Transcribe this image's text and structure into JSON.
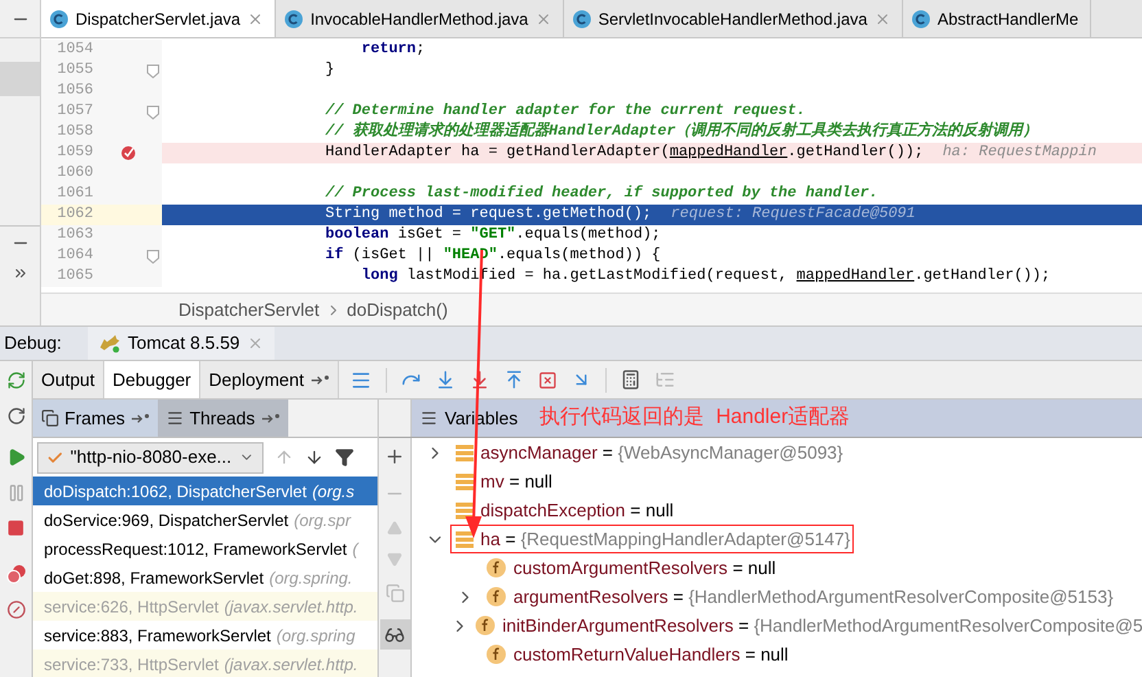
{
  "editor_tabs": [
    {
      "label": "DispatcherServlet.java",
      "selected": true
    },
    {
      "label": "InvocableHandlerMethod.java",
      "selected": false
    },
    {
      "label": "ServletInvocableHandlerMethod.java",
      "selected": false
    },
    {
      "label": "AbstractHandlerMe",
      "selected": false
    }
  ],
  "code_lines": [
    {
      "number": "1054",
      "current": false,
      "breakpoint": false,
      "fold": false,
      "segments": [
        {
          "kind": "keyword",
          "text": "    return"
        },
        {
          "kind": "plain",
          "text": ";"
        }
      ]
    },
    {
      "number": "1055",
      "current": false,
      "breakpoint": false,
      "fold": true,
      "segments": [
        {
          "kind": "plain",
          "text": "}"
        }
      ]
    },
    {
      "number": "1056",
      "current": false,
      "breakpoint": false,
      "fold": false
    },
    {
      "number": "1057",
      "current": false,
      "breakpoint": false,
      "fold": true,
      "segments": [
        {
          "kind": "comment",
          "text": "// Determine handler adapter for the current request."
        }
      ]
    },
    {
      "number": "1058",
      "current": false,
      "breakpoint": false,
      "fold": false,
      "segments": [
        {
          "kind": "comment",
          "text": "// 获取处理请求的处理器适配器HandlerAdapter（调用不同的反射工具类去执行真正方法的反射调用）"
        }
      ]
    },
    {
      "number": "1059",
      "current": false,
      "breakpoint": true,
      "fold": false,
      "segments": [
        {
          "kind": "plain",
          "text": "HandlerAdapter ha = getHandlerAdapter("
        },
        {
          "kind": "link",
          "text": "mappedHandler"
        },
        {
          "kind": "plain",
          "text": ".getHandler());"
        },
        {
          "kind": "hint",
          "text": "ha: RequestMappin"
        }
      ]
    },
    {
      "number": "1060",
      "current": false,
      "breakpoint": false,
      "fold": false
    },
    {
      "number": "1061",
      "current": false,
      "breakpoint": false,
      "fold": false,
      "segments": [
        {
          "kind": "comment",
          "text": "// Process last-modified header, if supported by the handler."
        }
      ]
    },
    {
      "number": "1062",
      "current": true,
      "breakpoint": false,
      "fold": false,
      "segments": [
        {
          "kind": "plain",
          "text": "String method = request.getMethod();"
        },
        {
          "kind": "hint",
          "text": "request: RequestFacade@5091"
        }
      ]
    },
    {
      "number": "1063",
      "current": false,
      "breakpoint": false,
      "fold": false,
      "segments": [
        {
          "kind": "keyword",
          "text": "boolean"
        },
        {
          "kind": "plain",
          "text": " isGet = "
        },
        {
          "kind": "string",
          "text": "\"GET\""
        },
        {
          "kind": "plain",
          "text": ".equals(method);"
        }
      ]
    },
    {
      "number": "1064",
      "current": false,
      "breakpoint": false,
      "fold": true,
      "segments": [
        {
          "kind": "keyword",
          "text": "if"
        },
        {
          "kind": "plain",
          "text": " (isGet || "
        },
        {
          "kind": "string",
          "text": "\"HEAD\""
        },
        {
          "kind": "plain",
          "text": ".equals(method)) {"
        }
      ]
    },
    {
      "number": "1065",
      "current": false,
      "breakpoint": false,
      "fold": false,
      "segments": [
        {
          "kind": "keyword",
          "text": "    long"
        },
        {
          "kind": "plain",
          "text": " lastModified = ha.getLastModified(request, "
        },
        {
          "kind": "link",
          "text": "mappedHandler"
        },
        {
          "kind": "plain",
          "text": ".getHandler());"
        }
      ]
    }
  ],
  "breadcrumb": [
    "DispatcherServlet",
    "doDispatch()"
  ],
  "debug": {
    "label": "Debug:",
    "session_tab": "Tomcat 8.5.59"
  },
  "debug_tabs": [
    {
      "label": "Output",
      "selected": false
    },
    {
      "label": "Debugger",
      "selected": true
    },
    {
      "label": "Deployment",
      "selected": false
    }
  ],
  "frames_tabs": [
    {
      "label": "Frames",
      "selected": true
    },
    {
      "label": "Threads",
      "selected": false
    }
  ],
  "thread_dropdown": "\"http-nio-8080-exe...",
  "frames": [
    {
      "method": "doDispatch:1062, DispatcherServlet",
      "package": "(org.s",
      "selected": true,
      "library": false
    },
    {
      "method": "doService:969, DispatcherServlet",
      "package": "(org.spr",
      "selected": false,
      "library": false
    },
    {
      "method": "processRequest:1012, FrameworkServlet",
      "package": "(",
      "selected": false,
      "library": false
    },
    {
      "method": "doGet:898, FrameworkServlet",
      "package": "(org.spring.",
      "selected": false,
      "library": false
    },
    {
      "method": "service:626, HttpServlet",
      "package": "(javax.servlet.http.",
      "selected": false,
      "library": true
    },
    {
      "method": "service:883, FrameworkServlet",
      "package": "(org.spring",
      "selected": false,
      "library": false
    },
    {
      "method": "service:733, HttpServlet",
      "package": "(javax.servlet.http.",
      "selected": false,
      "library": true
    }
  ],
  "variables_title": "Variables",
  "annotation": "执行代码返回的是  Handler适配器",
  "variables": [
    {
      "kind": "local",
      "name": "asyncManager",
      "op": "=",
      "value": "{WebAsyncManager@5093}",
      "grey_value": true,
      "expandable": true,
      "expanded": false,
      "annotated": false
    },
    {
      "kind": "local",
      "name": "mv",
      "op": "=",
      "value": "null",
      "grey_value": false,
      "expandable": false,
      "expanded": false,
      "annotated": false
    },
    {
      "kind": "local",
      "name": "dispatchException",
      "op": "=",
      "value": "null",
      "grey_value": false,
      "expandable": false,
      "expanded": false,
      "annotated": false
    },
    {
      "kind": "local",
      "name": "ha",
      "op": "=",
      "value": "{RequestMappingHandlerAdapter@5147}",
      "grey_value": true,
      "expandable": true,
      "expanded": true,
      "annotated": true,
      "children": [
        {
          "kind": "field",
          "name": "customArgumentResolvers",
          "op": "=",
          "value": "null",
          "grey_value": false,
          "expandable": false,
          "expanded": false,
          "annotated": false
        },
        {
          "kind": "field",
          "name": "argumentResolvers",
          "op": "=",
          "value": "{HandlerMethodArgumentResolverComposite@5153}",
          "grey_value": true,
          "expandable": true,
          "expanded": false,
          "annotated": false
        },
        {
          "kind": "field",
          "name": "initBinderArgumentResolvers",
          "op": "=",
          "value": "{HandlerMethodArgumentResolverComposite@5",
          "grey_value": true,
          "expandable": true,
          "expanded": false,
          "annotated": false
        },
        {
          "kind": "field",
          "name": "customReturnValueHandlers",
          "op": "=",
          "value": "null",
          "grey_value": false,
          "expandable": false,
          "expanded": false,
          "annotated": false
        }
      ]
    }
  ]
}
